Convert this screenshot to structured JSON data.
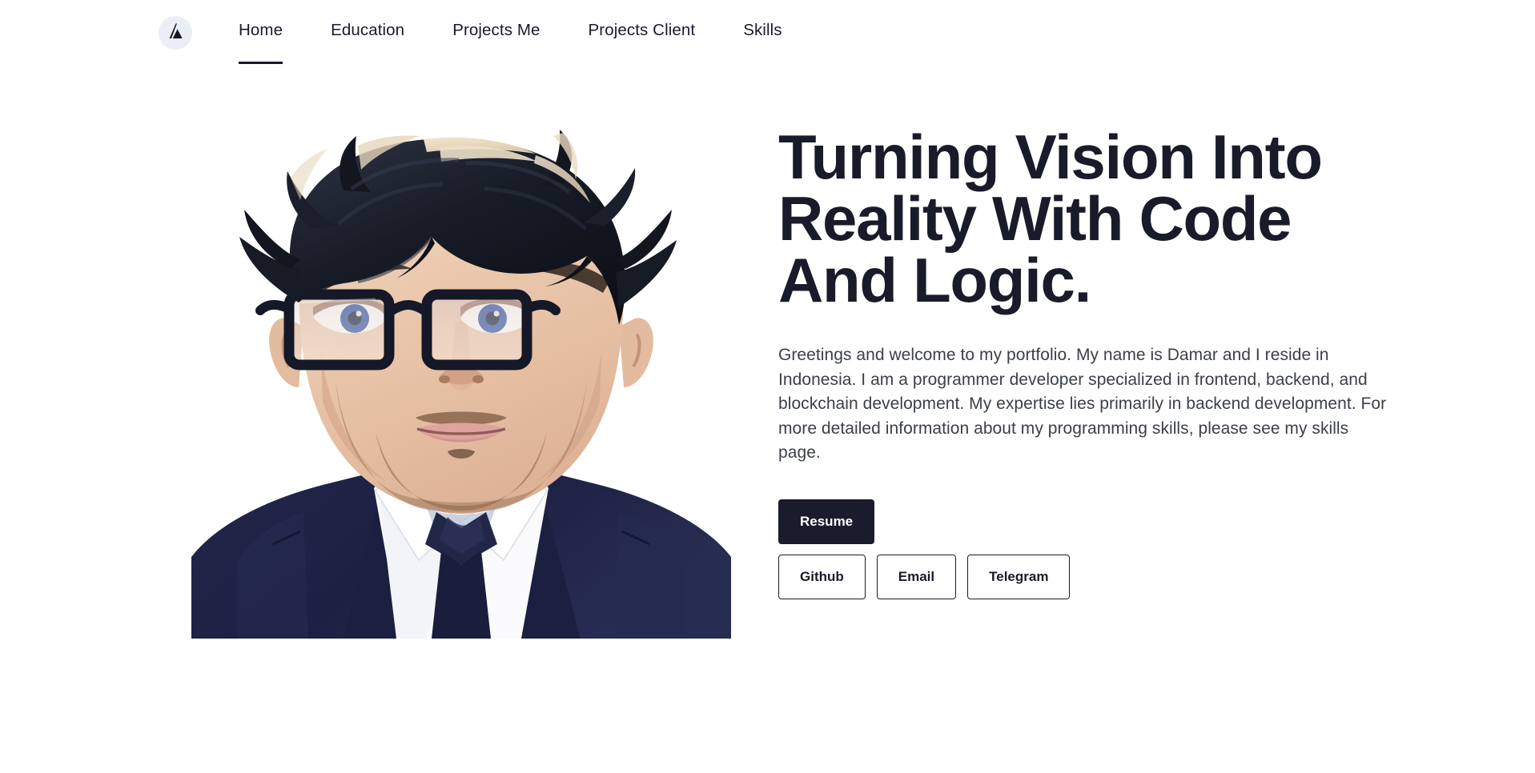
{
  "navbar": {
    "logo_icon": "stylized-a-logo-icon",
    "logo_bg": "#eaeef6",
    "items": [
      {
        "label": "Home",
        "active": true
      },
      {
        "label": "Education",
        "active": false
      },
      {
        "label": "Projects Me",
        "active": false
      },
      {
        "label": "Projects Client",
        "active": false
      },
      {
        "label": "Skills",
        "active": false
      }
    ]
  },
  "hero": {
    "portrait_alt": "illustrated-portrait-of-man-with-glasses-in-navy-suit",
    "title": "Turning Vision Into Reality With Code And Logic.",
    "description": "Greetings and welcome to my portfolio. My name is Damar and I reside in Indonesia. I am a programmer developer specialized in frontend, backend, and blockchain development. My expertise lies primarily in backend development. For more detailed information about my programming skills, please see my skills page.",
    "primary_button": {
      "label": "Resume"
    },
    "secondary_buttons": [
      {
        "label": "Github"
      },
      {
        "label": "Email"
      },
      {
        "label": "Telegram"
      }
    ]
  },
  "colors": {
    "text_dark": "#1a1b2a",
    "button_fill": "#1a1b2c",
    "body_text": "#3b3f48",
    "background": "#ffffff",
    "logo_circle": "#eaeef6"
  }
}
